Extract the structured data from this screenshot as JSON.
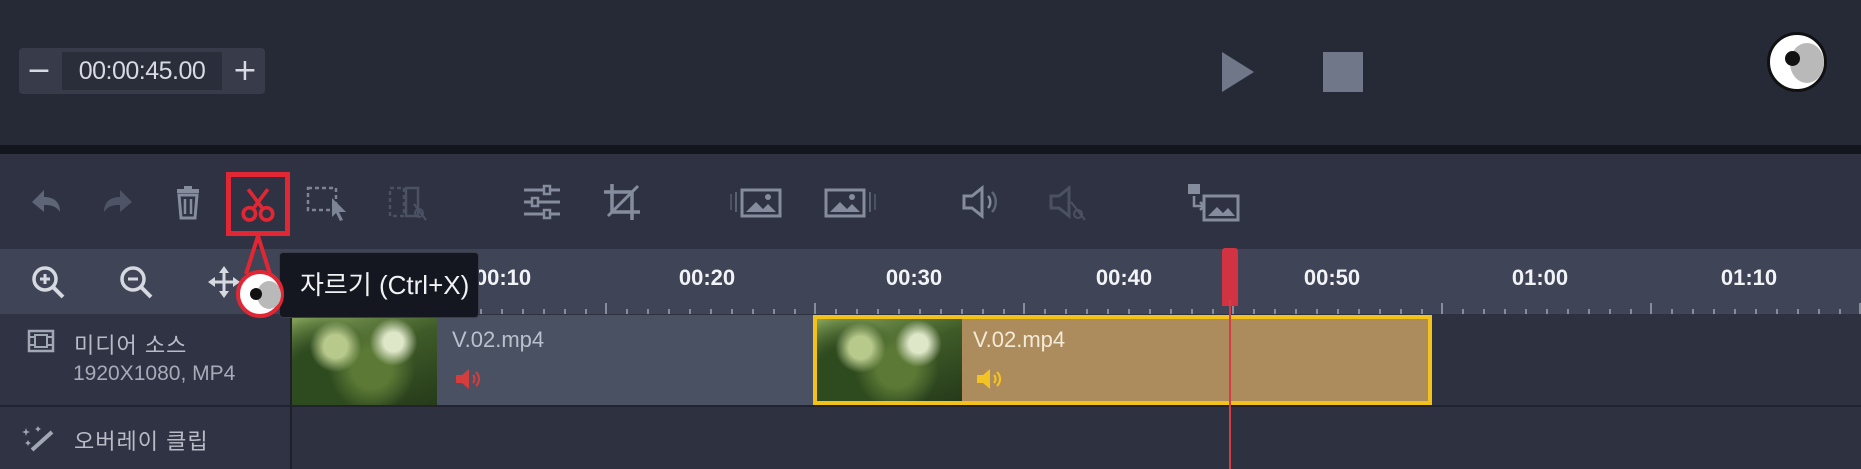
{
  "preview": {
    "time_value": "00:00:45.00",
    "minus_label": "−",
    "plus_label": "+",
    "play_icon": "play-icon",
    "stop_icon": "stop-icon"
  },
  "toolbar": {
    "icons": [
      "undo-icon",
      "redo-icon",
      "trash-icon",
      "scissors-icon",
      "select-region-icon",
      "split-disabled-icon",
      "adjust-sliders-icon",
      "crop-icon",
      "fade-in-image-icon",
      "fade-out-image-icon",
      "volume-icon",
      "mute-split-icon",
      "replace-media-icon"
    ]
  },
  "ruler": {
    "labels": [
      "00:10",
      "00:20",
      "00:30",
      "00:40",
      "00:50",
      "01:00",
      "01:10"
    ],
    "tools": [
      "zoom-in-icon",
      "zoom-out-icon",
      "move-icon"
    ]
  },
  "tooltip": {
    "text": "자르기 (Ctrl+X)"
  },
  "tracks": {
    "media": {
      "title": "미디어 소스",
      "subtitle": "1920X1080, MP4"
    },
    "overlay": {
      "title": "오버레이 클립"
    }
  },
  "clips": [
    {
      "name": "V.02.mp4",
      "selected": false,
      "audio_color": "#d53c3c"
    },
    {
      "name": "V.02.mp4",
      "selected": true,
      "audio_color": "#f3c223"
    }
  ],
  "colors": {
    "accent": "#e12734",
    "playhead": "#d43c47",
    "selected_clip_border": "#f2c21a"
  }
}
